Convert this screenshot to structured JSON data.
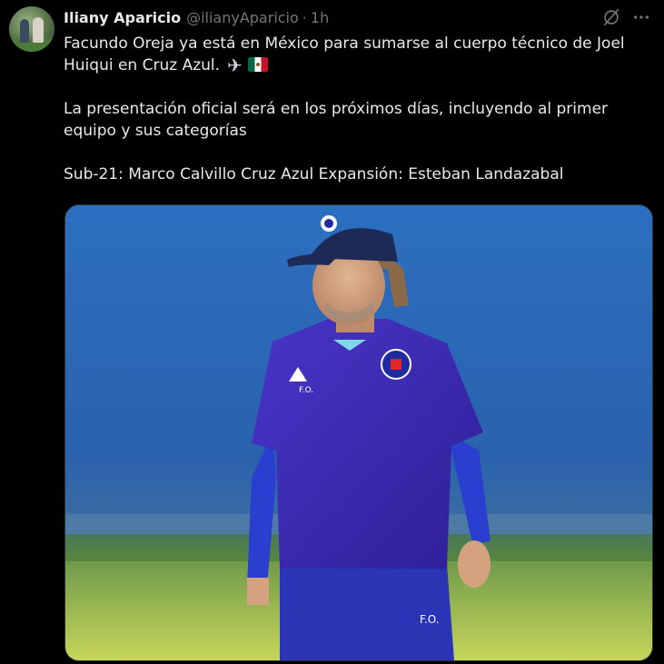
{
  "author": {
    "display_name": "Iliany Aparicio",
    "handle": "@ilianyAparicio",
    "separator": "·",
    "time": "1h"
  },
  "icons": {
    "grok": "grok-icon",
    "more": "more-options-icon",
    "plane": "airplane-icon",
    "flag": "mexico-flag-icon"
  },
  "tweet": {
    "line1": "Facundo Oreja ya está en México para sumarse al cuerpo técnico de Joel Huiqui en Cruz Azul.",
    "plane_glyph": "✈",
    "line2": "La presentación oficial será en los próximos días, incluyendo al primer equipo y sus categorías",
    "line3": "Sub-21: Marco Calvillo Cruz Azul Expansión: Esteban Landazabal"
  },
  "media": {
    "shirt_initials": "F.O.",
    "shorts_initials": "F.O."
  },
  "colors": {
    "background": "#000000",
    "text": "#e7e9ea",
    "muted": "#71767b",
    "kit_purple": "#3a2bb0"
  }
}
